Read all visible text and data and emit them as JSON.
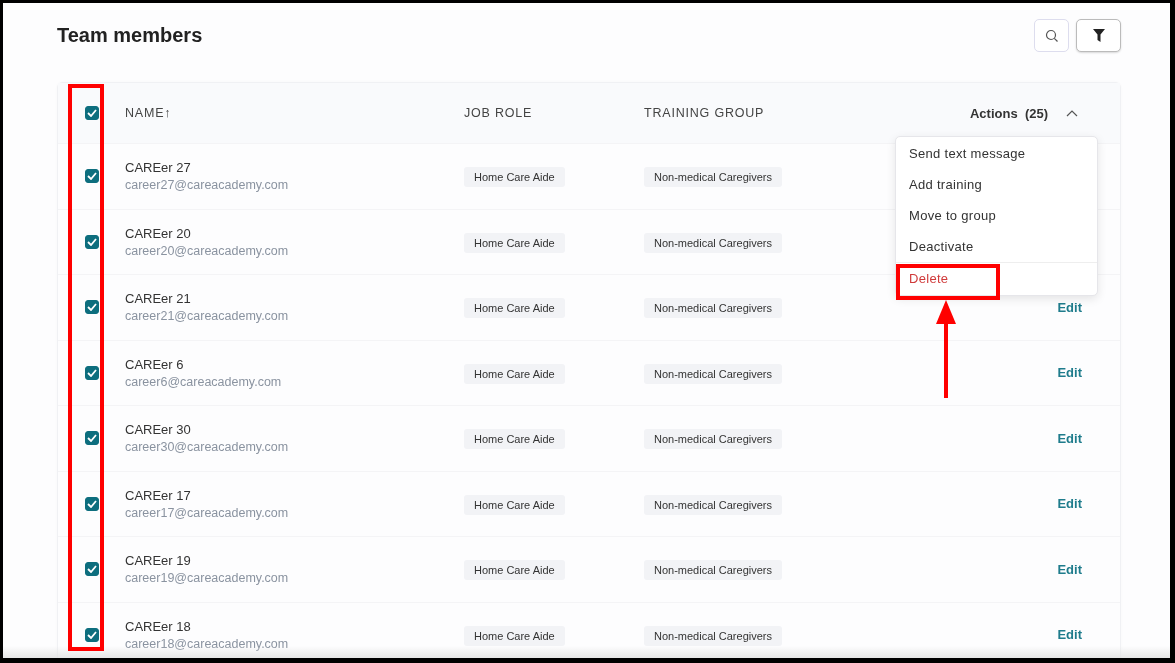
{
  "title": "Team members",
  "toolbar": {
    "search": true,
    "filter": true
  },
  "table": {
    "select_all_checked": true,
    "columns": [
      "NAME↑",
      "JOB ROLE",
      "TRAINING GROUP"
    ],
    "actions_button": {
      "label": "Actions",
      "count": "(25)",
      "expanded": true
    },
    "menu": [
      {
        "label": "Send text message",
        "kind": "normal"
      },
      {
        "label": "Add training",
        "kind": "normal"
      },
      {
        "label": "Move to group",
        "kind": "normal"
      },
      {
        "label": "Deactivate",
        "kind": "normal"
      },
      {
        "label": "Delete",
        "kind": "danger"
      }
    ],
    "rows": [
      {
        "name": "CAREer 27",
        "email": "career27@careacademy.com",
        "job_role": "Home Care Aide",
        "training_group": "Non-medical Caregivers",
        "checked": true
      },
      {
        "name": "CAREer 20",
        "email": "career20@careacademy.com",
        "job_role": "Home Care Aide",
        "training_group": "Non-medical Caregivers",
        "checked": true
      },
      {
        "name": "CAREer 21",
        "email": "career21@careacademy.com",
        "job_role": "Home Care Aide",
        "training_group": "Non-medical Caregivers",
        "checked": true,
        "action": "Edit"
      },
      {
        "name": "CAREer 6",
        "email": "career6@careacademy.com",
        "job_role": "Home Care Aide",
        "training_group": "Non-medical Caregivers",
        "checked": true,
        "action": "Edit"
      },
      {
        "name": "CAREer 30",
        "email": "career30@careacademy.com",
        "job_role": "Home Care Aide",
        "training_group": "Non-medical Caregivers",
        "checked": true,
        "action": "Edit"
      },
      {
        "name": "CAREer 17",
        "email": "career17@careacademy.com",
        "job_role": "Home Care Aide",
        "training_group": "Non-medical Caregivers",
        "checked": true,
        "action": "Edit"
      },
      {
        "name": "CAREer 19",
        "email": "career19@careacademy.com",
        "job_role": "Home Care Aide",
        "training_group": "Non-medical Caregivers",
        "checked": true,
        "action": "Edit"
      },
      {
        "name": "CAREer 18",
        "email": "career18@careacademy.com",
        "job_role": "Home Care Aide",
        "training_group": "Non-medical Caregivers",
        "checked": true,
        "action": "Edit"
      }
    ]
  }
}
